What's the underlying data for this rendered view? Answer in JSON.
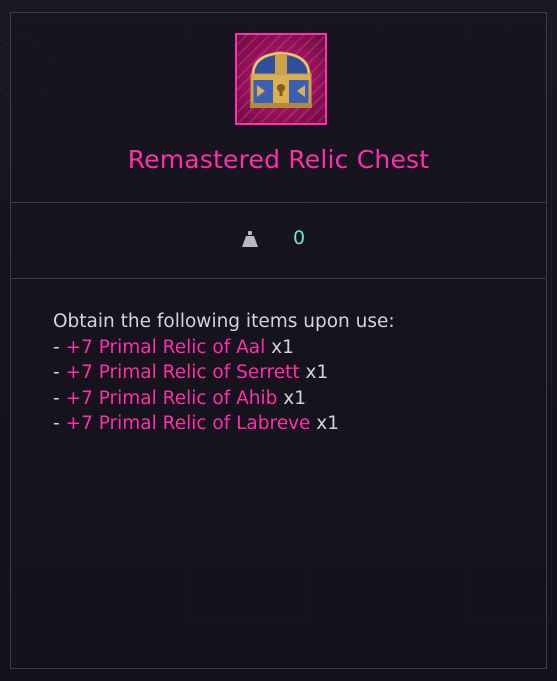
{
  "item": {
    "name": "Remastered Relic Chest",
    "icon": "treasure-chest-icon",
    "grade_color": "#ff2fac"
  },
  "stats": {
    "weight_icon": "weight-icon",
    "weight_value": "0"
  },
  "description": {
    "intro": "Obtain the following items upon use:",
    "rewards": [
      {
        "prefix": "- ",
        "name": "+7 Primal Relic of Aal",
        "qty": " x1"
      },
      {
        "prefix": "- ",
        "name": "+7 Primal Relic of Serrett",
        "qty": " x1"
      },
      {
        "prefix": "- ",
        "name": "+7 Primal Relic of Ahib",
        "qty": " x1"
      },
      {
        "prefix": "- ",
        "name": "+7 Primal Relic of Labreve",
        "qty": " x1"
      }
    ]
  }
}
